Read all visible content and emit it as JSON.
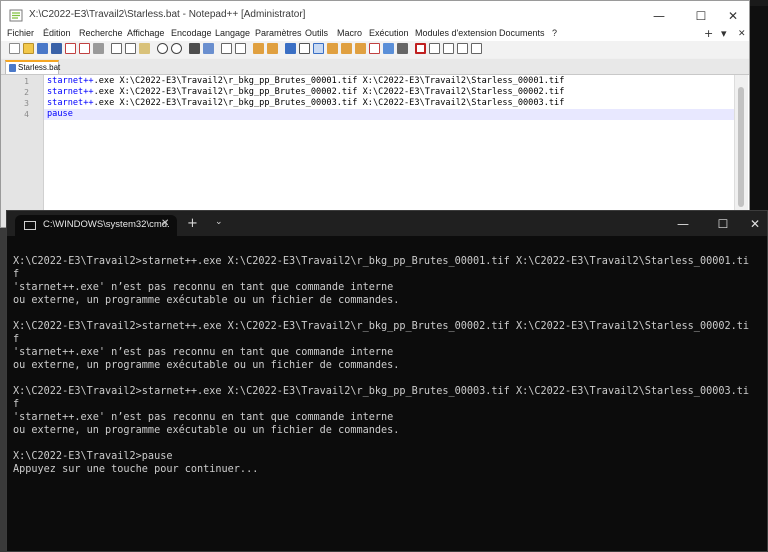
{
  "npp": {
    "title": "X:\\C2022-E3\\Travail2\\Starless.bat - Notepad++ [Administrator]",
    "controls": {
      "minimize": "—",
      "maximize": "☐",
      "close": "✕"
    },
    "menu": [
      "Fichier",
      "Édition",
      "Recherche",
      "Affichage",
      "Encodage",
      "Langage",
      "Paramètres",
      "Outils",
      "Macro",
      "Exécution",
      "Modules d'extension",
      "Documents",
      "?"
    ],
    "menu_right": {
      "plus": "+",
      "arrow": "▾",
      "close": "✕"
    },
    "tab_label": "Starless.bat",
    "line_numbers": [
      "1",
      "2",
      "3",
      "4"
    ],
    "lines": [
      {
        "cmd": "starnet++",
        "rest": ".exe X:\\C2022-E3\\Travail2\\r_bkg_pp_Brutes_00001.tif X:\\C2022-E3\\Travail2\\Starless_00001.tif"
      },
      {
        "cmd": "starnet++",
        "rest": ".exe X:\\C2022-E3\\Travail2\\r_bkg_pp_Brutes_00002.tif X:\\C2022-E3\\Travail2\\Starless_00002.tif"
      },
      {
        "cmd": "starnet++",
        "rest": ".exe X:\\C2022-E3\\Travail2\\r_bkg_pp_Brutes_00003.tif X:\\C2022-E3\\Travail2\\Starless_00003.tif"
      },
      {
        "cmd": "pause",
        "rest": ""
      }
    ],
    "colors": {
      "keyword": "#0000ff",
      "accent_tab": "#f5a623",
      "current_line": "#e8e8ff"
    }
  },
  "cmd": {
    "tab_title": "C:\\WINDOWS\\system32\\cmd.",
    "tab_close": "✕",
    "new_tab": "+",
    "dropdown": "⌄",
    "controls": {
      "minimize": "—",
      "maximize": "☐",
      "close": "✕"
    },
    "output": [
      "X:\\C2022-E3\\Travail2>starnet++.exe X:\\C2022-E3\\Travail2\\r_bkg_pp_Brutes_00001.tif X:\\C2022-E3\\Travail2\\Starless_00001.ti",
      "f",
      "'starnet++.exe' n’est pas reconnu en tant que commande interne",
      "ou externe, un programme exécutable ou un fichier de commandes.",
      "",
      "X:\\C2022-E3\\Travail2>starnet++.exe X:\\C2022-E3\\Travail2\\r_bkg_pp_Brutes_00002.tif X:\\C2022-E3\\Travail2\\Starless_00002.ti",
      "f",
      "'starnet++.exe' n’est pas reconnu en tant que commande interne",
      "ou externe, un programme exécutable ou un fichier de commandes.",
      "",
      "X:\\C2022-E3\\Travail2>starnet++.exe X:\\C2022-E3\\Travail2\\r_bkg_pp_Brutes_00003.tif X:\\C2022-E3\\Travail2\\Starless_00003.ti",
      "f",
      "'starnet++.exe' n’est pas reconnu en tant que commande interne",
      "ou externe, un programme exécutable ou un fichier de commandes.",
      "",
      "X:\\C2022-E3\\Travail2>pause",
      "Appuyez sur une touche pour continuer..."
    ]
  }
}
